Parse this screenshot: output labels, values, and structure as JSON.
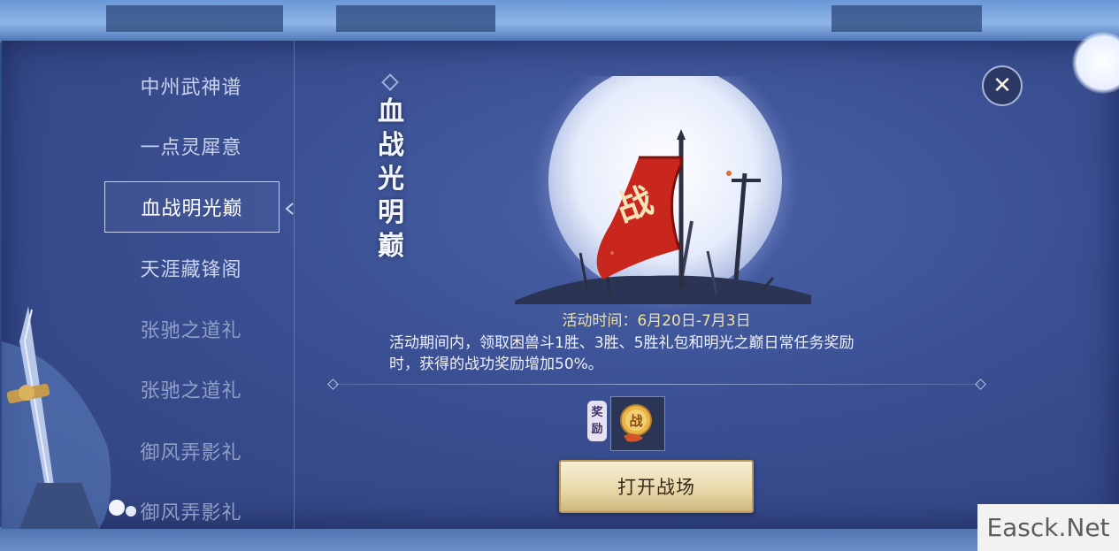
{
  "sidebar": {
    "items": [
      {
        "label": "中州武神谱"
      },
      {
        "label": "一点灵犀意"
      },
      {
        "label": "血战明光巅"
      },
      {
        "label": "天涯藏锋阁"
      },
      {
        "label": "张驰之道礼"
      },
      {
        "label": "张驰之道礼"
      },
      {
        "label": "御风弄影礼"
      },
      {
        "label": "御风弄影礼"
      }
    ],
    "active_index": 2
  },
  "event": {
    "title_chars": [
      "血",
      "战",
      "光",
      "明",
      "巅"
    ],
    "banner_glyph": "战",
    "time_text": "活动时间：6月20日-7月3日",
    "description_line1": "活动期间内，领取困兽斗1胜、3胜、5胜礼包和明光之巅日常任务奖励",
    "description_line2": "时，获得的战功奖励增加50%。",
    "reward_label_chars": [
      "奖",
      "励"
    ],
    "reward_item_glyph": "战",
    "open_button_label": "打开战场"
  },
  "close_button": {
    "icon": "close-icon",
    "glyph": "✕"
  },
  "watermark": {
    "text": "Easck.Net"
  },
  "colors": {
    "panel": "#3a4f92",
    "accent_gold": "#f0e1a0",
    "banner_red": "#c9261e",
    "button_gold": "#e7d7a8"
  }
}
